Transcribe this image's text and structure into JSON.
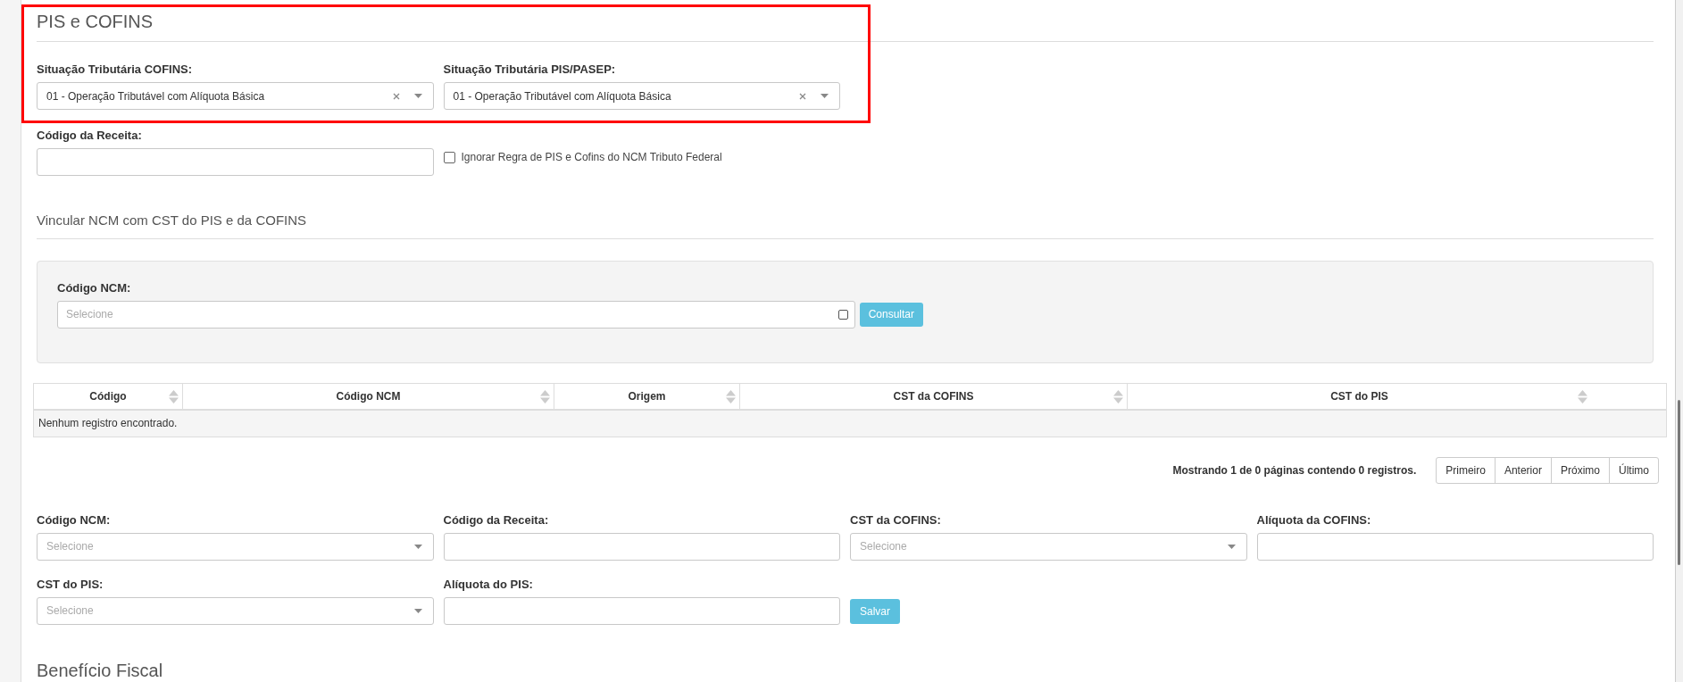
{
  "section_title": "PIS e COFINS",
  "tax_situation_fields": [
    {
      "label": "Situação Tributária COFINS:",
      "value": "01 - Operação Tributável com Alíquota Básica"
    },
    {
      "label": "Situação Tributária PIS/PASEP:",
      "value": "01 - Operação Tributável com Alíquota Básica"
    }
  ],
  "revenue_code": {
    "label": "Código da Receita:"
  },
  "ignore_rule_checkbox": {
    "label": "Ignorar Regra de PIS e Cofins do NCM Tributo Federal",
    "checked": false
  },
  "link_section": {
    "title": "Vincular NCM com CST do PIS e da COFINS",
    "search": {
      "label": "Código NCM:",
      "placeholder": "Selecione",
      "button": "Consultar"
    }
  },
  "table": {
    "columns": [
      "Código",
      "Código NCM",
      "Origem",
      "CST da COFINS",
      "CST do PIS"
    ],
    "empty_message": "Nenhum registro encontrado."
  },
  "pagination": {
    "summary": "Mostrando 1 de 0 páginas contendo 0 registros.",
    "buttons": [
      "Primeiro",
      "Anterior",
      "Próximo",
      "Último"
    ]
  },
  "form_fields": [
    {
      "kind": "select",
      "label": "Código NCM:",
      "placeholder": "Selecione"
    },
    {
      "kind": "text",
      "label": "Código da Receita:"
    },
    {
      "kind": "select",
      "label": "CST da COFINS:",
      "placeholder": "Selecione"
    },
    {
      "kind": "text",
      "label": "Alíquota da COFINS:"
    },
    {
      "kind": "select",
      "label": "CST do PIS:",
      "placeholder": "Selecione"
    },
    {
      "kind": "text",
      "label": "Alíquota do PIS:"
    }
  ],
  "save_button": "Salvar",
  "next_section_title": "Benefício Fiscal"
}
